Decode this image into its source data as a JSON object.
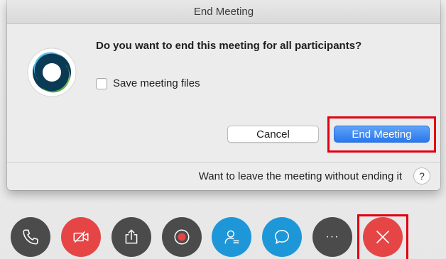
{
  "window": {
    "title": "End Meeting"
  },
  "dialog": {
    "question": "Do you want to end this meeting for all participants?",
    "save_files_label": "Save meeting files",
    "save_files_checked": false,
    "cancel_label": "Cancel",
    "end_meeting_label": "End Meeting",
    "leave_prompt": "Want to leave the meeting without ending it",
    "help_label": "?"
  },
  "toolbar": {
    "controls": [
      {
        "name": "audio-button",
        "icon": "phone-icon"
      },
      {
        "name": "video-button",
        "icon": "video-off-icon"
      },
      {
        "name": "share-button",
        "icon": "share-icon"
      },
      {
        "name": "record-button",
        "icon": "record-icon"
      },
      {
        "name": "participants-button",
        "icon": "participants-icon"
      },
      {
        "name": "chat-button",
        "icon": "chat-icon"
      },
      {
        "name": "more-button",
        "icon": "more-icon"
      },
      {
        "name": "end-meeting-toolbar-button",
        "icon": "close-icon"
      }
    ],
    "more_label": "···"
  },
  "colors": {
    "accent_blue": "#2a78ee",
    "control_dark": "#4b4b4b",
    "control_red": "#e64545",
    "control_blue": "#1e97d8",
    "highlight_red": "#e0000f"
  }
}
